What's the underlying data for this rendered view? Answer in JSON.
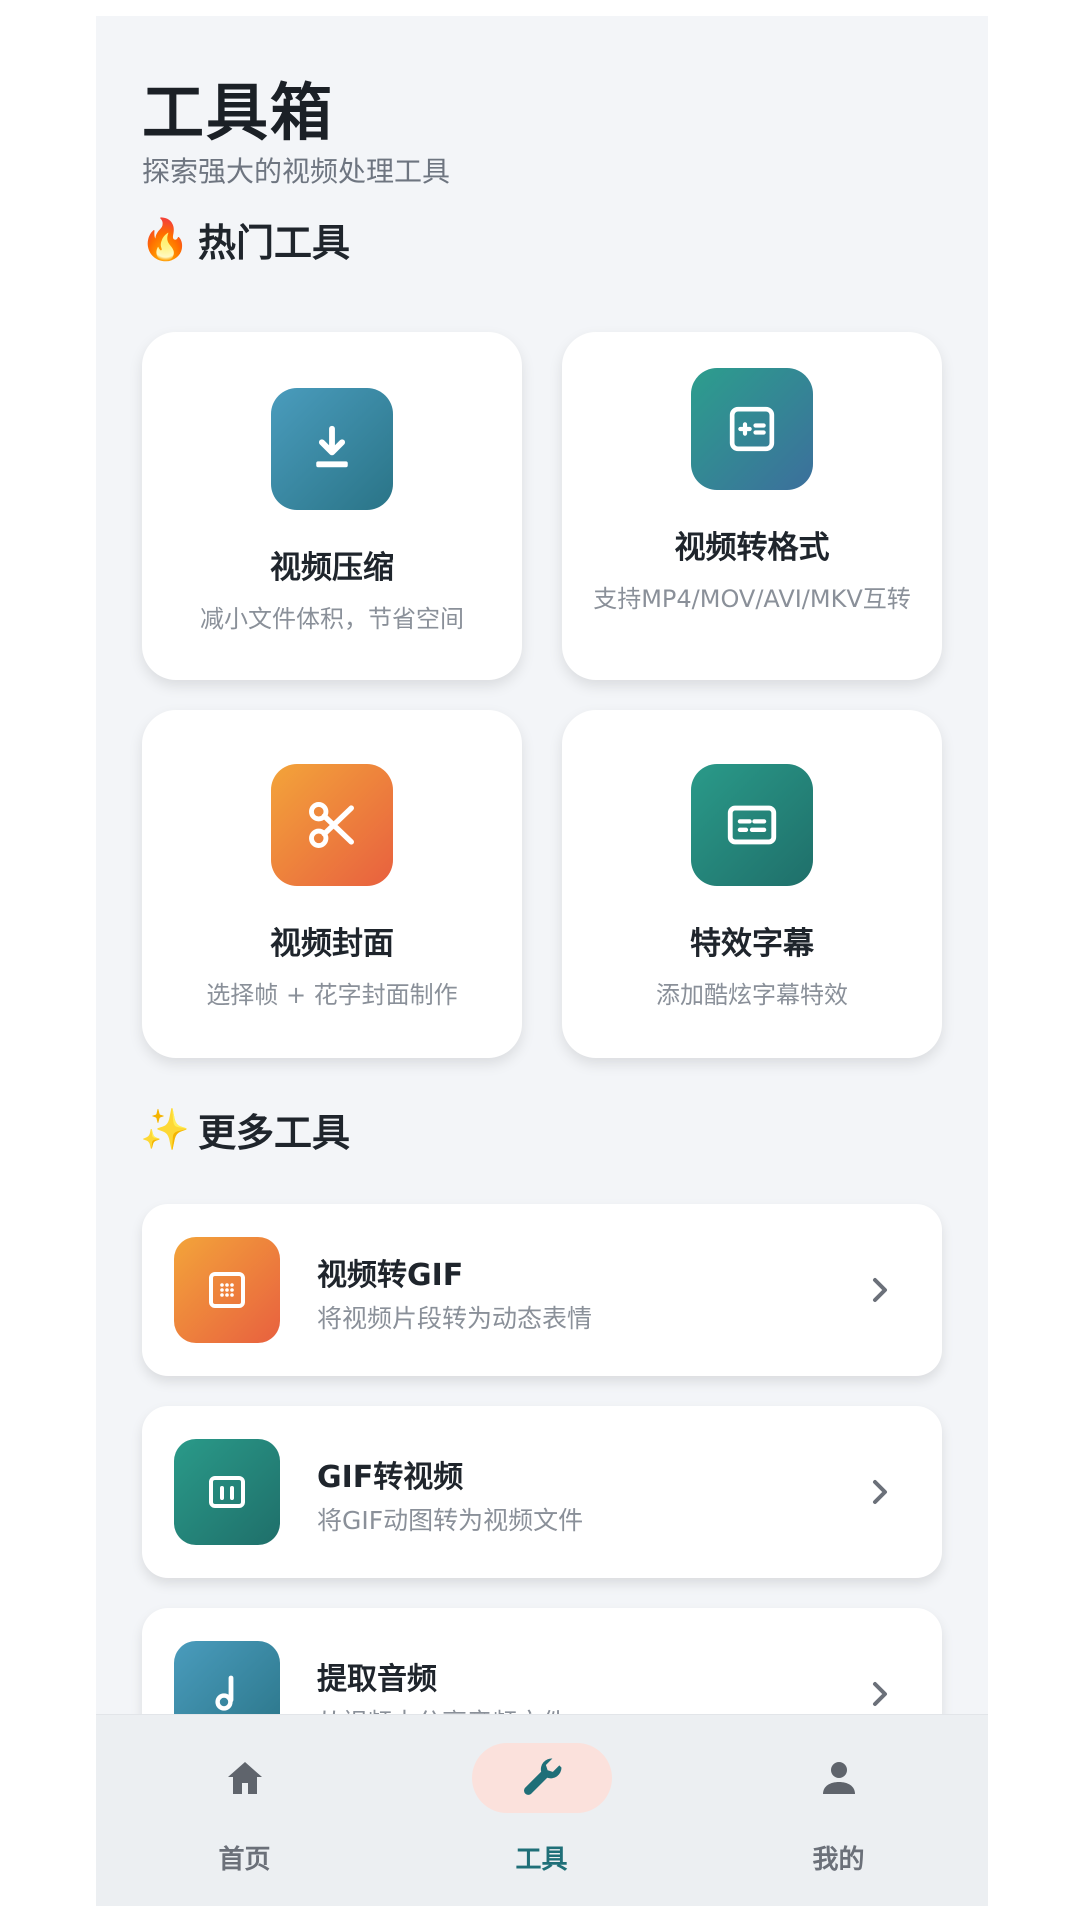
{
  "header": {
    "title": "工具箱",
    "subtitle": "探索强大的视频处理工具"
  },
  "hot_section": {
    "emoji": "🔥",
    "label": "热门工具",
    "cards": [
      {
        "title": "视频压缩",
        "desc": "减小文件体积，节省空间",
        "icon": "download-icon",
        "color": "#3b8aa6"
      },
      {
        "title": "视频转格式",
        "desc": "支持MP4/MOV/AVI/MKV互转",
        "icon": "convert-format-icon",
        "color": "#2e8c8e"
      },
      {
        "title": "视频封面",
        "desc": "选择帧 + 花字封面制作",
        "icon": "scissors-icon",
        "color": "#ee7d3c"
      },
      {
        "title": "特效字幕",
        "desc": "添加酷炫字幕特效",
        "icon": "subtitles-icon",
        "color": "#248a80"
      }
    ]
  },
  "more_section": {
    "emoji": "✨",
    "label": "更多工具",
    "items": [
      {
        "title": "视频转GIF",
        "desc": "将视频片段转为动态表情",
        "icon": "gif-icon",
        "color": "#ee7d3c"
      },
      {
        "title": "GIF转视频",
        "desc": "将GIF动图转为视频文件",
        "icon": "video-frame-icon",
        "color": "#248a80"
      },
      {
        "title": "提取音频",
        "desc": "从视频中分离音频文件",
        "icon": "music-note-icon",
        "color": "#3b8aa6"
      }
    ]
  },
  "bottom_nav": {
    "items": [
      {
        "label": "首页",
        "icon": "home-icon",
        "active": false
      },
      {
        "label": "工具",
        "icon": "wrench-icon",
        "active": true
      },
      {
        "label": "我的",
        "icon": "person-icon",
        "active": false
      }
    ],
    "active_color": "#1f6f78",
    "active_pill_color": "#fbe1dc"
  }
}
